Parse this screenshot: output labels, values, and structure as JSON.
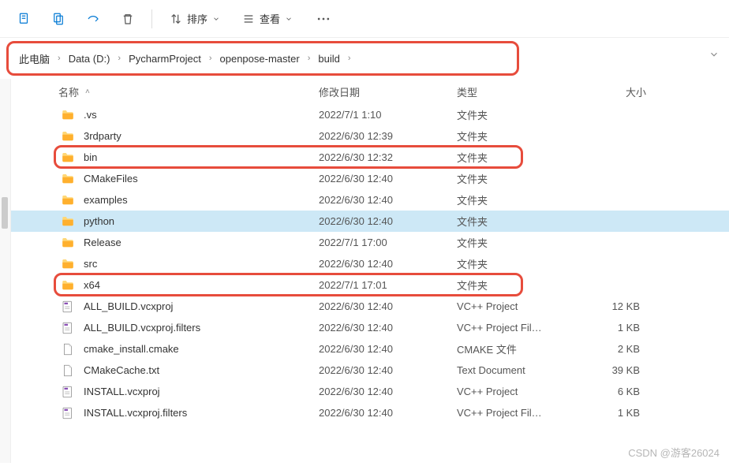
{
  "toolbar": {
    "sort_label": "排序",
    "view_label": "查看"
  },
  "breadcrumb": [
    "此电脑",
    "Data (D:)",
    "PycharmProject",
    "openpose-master",
    "build"
  ],
  "headers": {
    "name": "名称",
    "date": "修改日期",
    "type": "类型",
    "size": "大小"
  },
  "rows": [
    {
      "icon": "folder",
      "name": ".vs",
      "date": "2022/7/1 1:10",
      "type": "文件夹",
      "size": "",
      "selected": false,
      "highlighted": false
    },
    {
      "icon": "folder",
      "name": "3rdparty",
      "date": "2022/6/30 12:39",
      "type": "文件夹",
      "size": "",
      "selected": false,
      "highlighted": false
    },
    {
      "icon": "folder",
      "name": "bin",
      "date": "2022/6/30 12:32",
      "type": "文件夹",
      "size": "",
      "selected": false,
      "highlighted": true
    },
    {
      "icon": "folder",
      "name": "CMakeFiles",
      "date": "2022/6/30 12:40",
      "type": "文件夹",
      "size": "",
      "selected": false,
      "highlighted": false
    },
    {
      "icon": "folder",
      "name": "examples",
      "date": "2022/6/30 12:40",
      "type": "文件夹",
      "size": "",
      "selected": false,
      "highlighted": false
    },
    {
      "icon": "folder",
      "name": "python",
      "date": "2022/6/30 12:40",
      "type": "文件夹",
      "size": "",
      "selected": true,
      "highlighted": false
    },
    {
      "icon": "folder",
      "name": "Release",
      "date": "2022/7/1 17:00",
      "type": "文件夹",
      "size": "",
      "selected": false,
      "highlighted": false
    },
    {
      "icon": "folder",
      "name": "src",
      "date": "2022/6/30 12:40",
      "type": "文件夹",
      "size": "",
      "selected": false,
      "highlighted": false
    },
    {
      "icon": "folder",
      "name": "x64",
      "date": "2022/7/1 17:01",
      "type": "文件夹",
      "size": "",
      "selected": false,
      "highlighted": true
    },
    {
      "icon": "vcxproj",
      "name": "ALL_BUILD.vcxproj",
      "date": "2022/6/30 12:40",
      "type": "VC++ Project",
      "size": "12 KB",
      "selected": false,
      "highlighted": false
    },
    {
      "icon": "filters",
      "name": "ALL_BUILD.vcxproj.filters",
      "date": "2022/6/30 12:40",
      "type": "VC++ Project Fil…",
      "size": "1 KB",
      "selected": false,
      "highlighted": false
    },
    {
      "icon": "file",
      "name": "cmake_install.cmake",
      "date": "2022/6/30 12:40",
      "type": "CMAKE 文件",
      "size": "2 KB",
      "selected": false,
      "highlighted": false
    },
    {
      "icon": "file",
      "name": "CMakeCache.txt",
      "date": "2022/6/30 12:40",
      "type": "Text Document",
      "size": "39 KB",
      "selected": false,
      "highlighted": false
    },
    {
      "icon": "vcxproj",
      "name": "INSTALL.vcxproj",
      "date": "2022/6/30 12:40",
      "type": "VC++ Project",
      "size": "6 KB",
      "selected": false,
      "highlighted": false
    },
    {
      "icon": "filters",
      "name": "INSTALL.vcxproj.filters",
      "date": "2022/6/30 12:40",
      "type": "VC++ Project Fil…",
      "size": "1 KB",
      "selected": false,
      "highlighted": false
    }
  ],
  "watermark": "CSDN @游客26024"
}
